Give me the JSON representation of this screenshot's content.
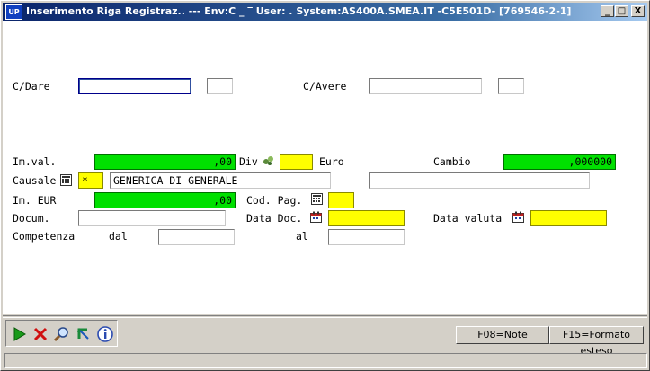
{
  "window": {
    "icon_text": "UP",
    "title": "Inserimento Riga Registraz.. --- Env:C  _   ‾ User:    . System:AS400A.SMEA.IT -C5E501D- [769546-2-1]",
    "minimize": "_",
    "maximize": "□",
    "close": "X"
  },
  "form": {
    "c_dare_label": "C/Dare",
    "c_dare_value": "",
    "c_dare_sub": "",
    "c_avere_label": "C/Avere",
    "c_avere_value": "",
    "c_avere_sub": "",
    "im_val_label": "Im.val.",
    "im_val_value": ",00",
    "div_label": "Div",
    "div_value": "",
    "euro_label": "Euro",
    "cambio_label": "Cambio",
    "cambio_value": ",000000",
    "causale_label": "Causale",
    "causale_code": "*",
    "causale_desc": "GENERICA DI GENERALE",
    "causale_extra": "",
    "im_eur_label": "Im. EUR",
    "im_eur_value": ",00",
    "cod_pag_label": "Cod. Pag.",
    "cod_pag_value": "",
    "docum_label": "Docum.",
    "docum_value": "",
    "data_doc_label": "Data Doc.",
    "data_doc_value": "",
    "data_valuta_label": "Data valuta",
    "data_valuta_value": "",
    "competenza_label": "Competenza",
    "dal_label": "dal",
    "dal_value": "",
    "al_label": "al",
    "al_value": ""
  },
  "fkeys": {
    "f08": "F08=Note",
    "f15": "F15=Formato esteso"
  },
  "colors": {
    "mandatory": "#ffff00",
    "numeric": "#00e000",
    "titlebar": "#0a246a"
  }
}
